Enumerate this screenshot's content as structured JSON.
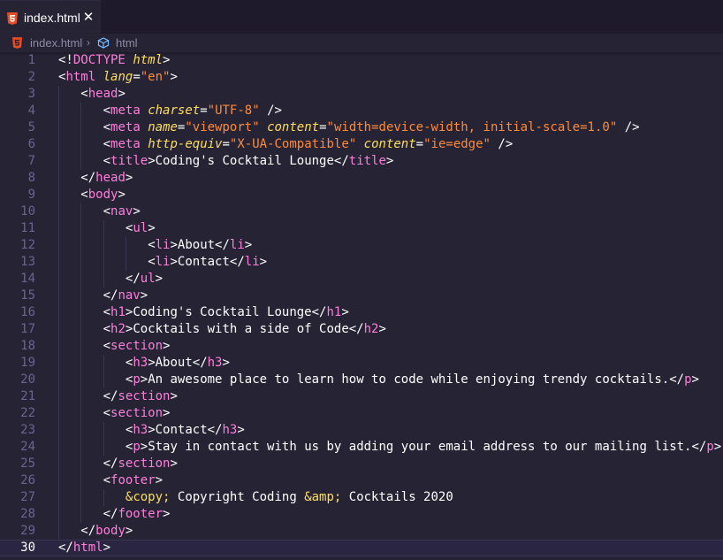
{
  "tab": {
    "label": "index.html",
    "close_glyph": "✕",
    "icon": "html5-file-icon"
  },
  "breadcrumb": {
    "file": "index.html",
    "separator": "›",
    "element": "html",
    "element_icon": "cube-icon"
  },
  "colors": {
    "background": "#262335",
    "tag_name": "#ff7edb",
    "attribute_name": "#fede5d",
    "attribute_value": "#ff8b39",
    "line_number": "#6a6590",
    "html_icon": "#e44d26"
  },
  "current_line": 30,
  "lines": [
    {
      "n": "1",
      "indent": 0,
      "tokens": [
        [
          "p",
          "<!"
        ],
        [
          "tn",
          "DOCTYPE"
        ],
        [
          "p",
          " "
        ],
        [
          "dt",
          "html"
        ],
        [
          "p",
          ">"
        ]
      ]
    },
    {
      "n": "2",
      "indent": 0,
      "tokens": [
        [
          "p",
          "<"
        ],
        [
          "tn",
          "html"
        ],
        [
          "p",
          " "
        ],
        [
          "an",
          "lang"
        ],
        [
          "eq",
          "="
        ],
        [
          "av",
          "\"en\""
        ],
        [
          "p",
          ">"
        ]
      ]
    },
    {
      "n": "3",
      "indent": 1,
      "tokens": [
        [
          "p",
          "<"
        ],
        [
          "tn",
          "head"
        ],
        [
          "p",
          ">"
        ]
      ]
    },
    {
      "n": "4",
      "indent": 2,
      "tokens": [
        [
          "p",
          "<"
        ],
        [
          "tn",
          "meta"
        ],
        [
          "p",
          " "
        ],
        [
          "an",
          "charset"
        ],
        [
          "eq",
          "="
        ],
        [
          "av",
          "\"UTF-8\""
        ],
        [
          "p",
          " />"
        ]
      ]
    },
    {
      "n": "5",
      "indent": 2,
      "tokens": [
        [
          "p",
          "<"
        ],
        [
          "tn",
          "meta"
        ],
        [
          "p",
          " "
        ],
        [
          "an",
          "name"
        ],
        [
          "eq",
          "="
        ],
        [
          "av",
          "\"viewport\""
        ],
        [
          "p",
          " "
        ],
        [
          "an",
          "content"
        ],
        [
          "eq",
          "="
        ],
        [
          "av",
          "\"width=device-width, initial-scale=1.0\""
        ],
        [
          "p",
          " />"
        ]
      ]
    },
    {
      "n": "6",
      "indent": 2,
      "tokens": [
        [
          "p",
          "<"
        ],
        [
          "tn",
          "meta"
        ],
        [
          "p",
          " "
        ],
        [
          "an",
          "http-equiv"
        ],
        [
          "eq",
          "="
        ],
        [
          "av",
          "\"X-UA-Compatible\""
        ],
        [
          "p",
          " "
        ],
        [
          "an",
          "content"
        ],
        [
          "eq",
          "="
        ],
        [
          "av",
          "\"ie=edge\""
        ],
        [
          "p",
          " />"
        ]
      ]
    },
    {
      "n": "7",
      "indent": 2,
      "tokens": [
        [
          "p",
          "<"
        ],
        [
          "tn",
          "title"
        ],
        [
          "p",
          ">Coding's Cocktail Lounge</"
        ],
        [
          "tn",
          "title"
        ],
        [
          "p",
          ">"
        ]
      ]
    },
    {
      "n": "8",
      "indent": 1,
      "tokens": [
        [
          "p",
          "</"
        ],
        [
          "tn",
          "head"
        ],
        [
          "p",
          ">"
        ]
      ]
    },
    {
      "n": "9",
      "indent": 1,
      "tokens": [
        [
          "p",
          "<"
        ],
        [
          "tn",
          "body"
        ],
        [
          "p",
          ">"
        ]
      ]
    },
    {
      "n": "10",
      "indent": 2,
      "tokens": [
        [
          "p",
          "<"
        ],
        [
          "tn",
          "nav"
        ],
        [
          "p",
          ">"
        ]
      ]
    },
    {
      "n": "11",
      "indent": 3,
      "tokens": [
        [
          "p",
          "<"
        ],
        [
          "tn",
          "ul"
        ],
        [
          "p",
          ">"
        ]
      ]
    },
    {
      "n": "12",
      "indent": 4,
      "tokens": [
        [
          "p",
          "<"
        ],
        [
          "tn",
          "li"
        ],
        [
          "p",
          ">About</"
        ],
        [
          "tn",
          "li"
        ],
        [
          "p",
          ">"
        ]
      ]
    },
    {
      "n": "13",
      "indent": 4,
      "tokens": [
        [
          "p",
          "<"
        ],
        [
          "tn",
          "li"
        ],
        [
          "p",
          ">Contact</"
        ],
        [
          "tn",
          "li"
        ],
        [
          "p",
          ">"
        ]
      ]
    },
    {
      "n": "14",
      "indent": 3,
      "tokens": [
        [
          "p",
          "</"
        ],
        [
          "tn",
          "ul"
        ],
        [
          "p",
          ">"
        ]
      ]
    },
    {
      "n": "15",
      "indent": 2,
      "tokens": [
        [
          "p",
          "</"
        ],
        [
          "tn",
          "nav"
        ],
        [
          "p",
          ">"
        ]
      ]
    },
    {
      "n": "16",
      "indent": 2,
      "tokens": [
        [
          "p",
          "<"
        ],
        [
          "tn",
          "h1"
        ],
        [
          "p",
          ">Coding's Cocktail Lounge</"
        ],
        [
          "tn",
          "h1"
        ],
        [
          "p",
          ">"
        ]
      ]
    },
    {
      "n": "17",
      "indent": 2,
      "tokens": [
        [
          "p",
          "<"
        ],
        [
          "tn",
          "h2"
        ],
        [
          "p",
          ">Cocktails with a side of Code</"
        ],
        [
          "tn",
          "h2"
        ],
        [
          "p",
          ">"
        ]
      ]
    },
    {
      "n": "18",
      "indent": 2,
      "tokens": [
        [
          "p",
          "<"
        ],
        [
          "tn",
          "section"
        ],
        [
          "p",
          ">"
        ]
      ]
    },
    {
      "n": "19",
      "indent": 3,
      "tokens": [
        [
          "p",
          "<"
        ],
        [
          "tn",
          "h3"
        ],
        [
          "p",
          ">About</"
        ],
        [
          "tn",
          "h3"
        ],
        [
          "p",
          ">"
        ]
      ]
    },
    {
      "n": "20",
      "indent": 3,
      "tokens": [
        [
          "p",
          "<"
        ],
        [
          "tn",
          "p"
        ],
        [
          "p",
          ">An awesome place to learn how to code while enjoying trendy cocktails.</"
        ],
        [
          "tn",
          "p"
        ],
        [
          "p",
          ">"
        ]
      ]
    },
    {
      "n": "21",
      "indent": 2,
      "tokens": [
        [
          "p",
          "</"
        ],
        [
          "tn",
          "section"
        ],
        [
          "p",
          ">"
        ]
      ]
    },
    {
      "n": "22",
      "indent": 2,
      "tokens": [
        [
          "p",
          "<"
        ],
        [
          "tn",
          "section"
        ],
        [
          "p",
          ">"
        ]
      ]
    },
    {
      "n": "23",
      "indent": 3,
      "tokens": [
        [
          "p",
          "<"
        ],
        [
          "tn",
          "h3"
        ],
        [
          "p",
          ">Contact</"
        ],
        [
          "tn",
          "h3"
        ],
        [
          "p",
          ">"
        ]
      ]
    },
    {
      "n": "24",
      "indent": 3,
      "tokens": [
        [
          "p",
          "<"
        ],
        [
          "tn",
          "p"
        ],
        [
          "p",
          ">Stay in contact with us by adding your email address to our mailing list.</"
        ],
        [
          "tn",
          "p"
        ],
        [
          "p",
          ">"
        ]
      ]
    },
    {
      "n": "25",
      "indent": 2,
      "tokens": [
        [
          "p",
          "</"
        ],
        [
          "tn",
          "section"
        ],
        [
          "p",
          ">"
        ]
      ]
    },
    {
      "n": "26",
      "indent": 2,
      "tokens": [
        [
          "p",
          "<"
        ],
        [
          "tn",
          "footer"
        ],
        [
          "p",
          ">"
        ]
      ]
    },
    {
      "n": "27",
      "indent": 3,
      "tokens": [
        [
          "ent",
          "&copy;"
        ],
        [
          "p",
          " Copyright Coding "
        ],
        [
          "ent",
          "&amp;"
        ],
        [
          "p",
          " Cocktails 2020"
        ]
      ]
    },
    {
      "n": "28",
      "indent": 2,
      "tokens": [
        [
          "p",
          "</"
        ],
        [
          "tn",
          "footer"
        ],
        [
          "p",
          ">"
        ]
      ]
    },
    {
      "n": "29",
      "indent": 1,
      "tokens": [
        [
          "p",
          "</"
        ],
        [
          "tn",
          "body"
        ],
        [
          "p",
          ">"
        ]
      ]
    },
    {
      "n": "30",
      "indent": 0,
      "tokens": [
        [
          "p",
          "</"
        ],
        [
          "tn",
          "html"
        ],
        [
          "p",
          ">"
        ]
      ]
    }
  ]
}
